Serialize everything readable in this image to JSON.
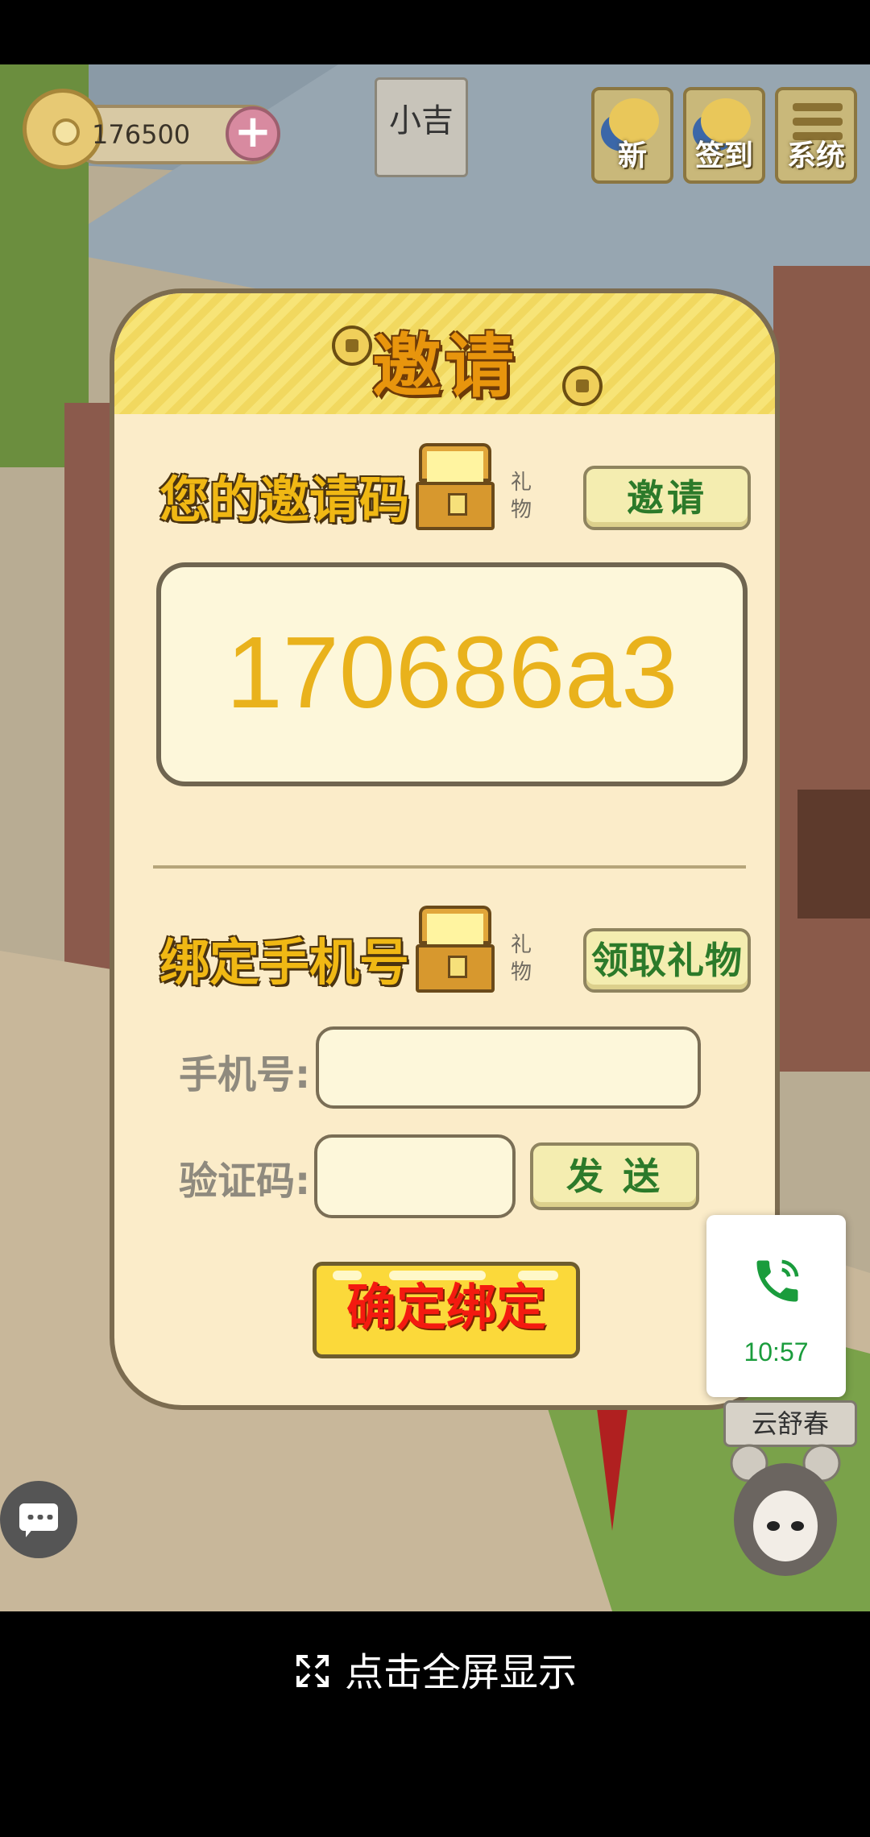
{
  "hud": {
    "coins": "176500",
    "character_tag": "小吉",
    "buttons": [
      {
        "label": "新"
      },
      {
        "label": "签到"
      },
      {
        "label": "系统"
      }
    ]
  },
  "dialog": {
    "title": "邀请",
    "invite_section": {
      "heading": "您的邀请码",
      "gift_label": "礼物",
      "button": "邀请",
      "code": "170686a3"
    },
    "bind_section": {
      "heading": "绑定手机号",
      "gift_label": "礼物",
      "button": "领取礼物",
      "phone_label": "手机号:",
      "phone_value": "",
      "code_label": "验证码:",
      "code_value": "",
      "send_button": "发 送",
      "confirm_button": "确定绑定"
    }
  },
  "call": {
    "time": "10:57",
    "accent": "#1a9c3c"
  },
  "character": {
    "name": "云舒春"
  },
  "footer": {
    "fullscreen_label": "点击全屏显示"
  }
}
